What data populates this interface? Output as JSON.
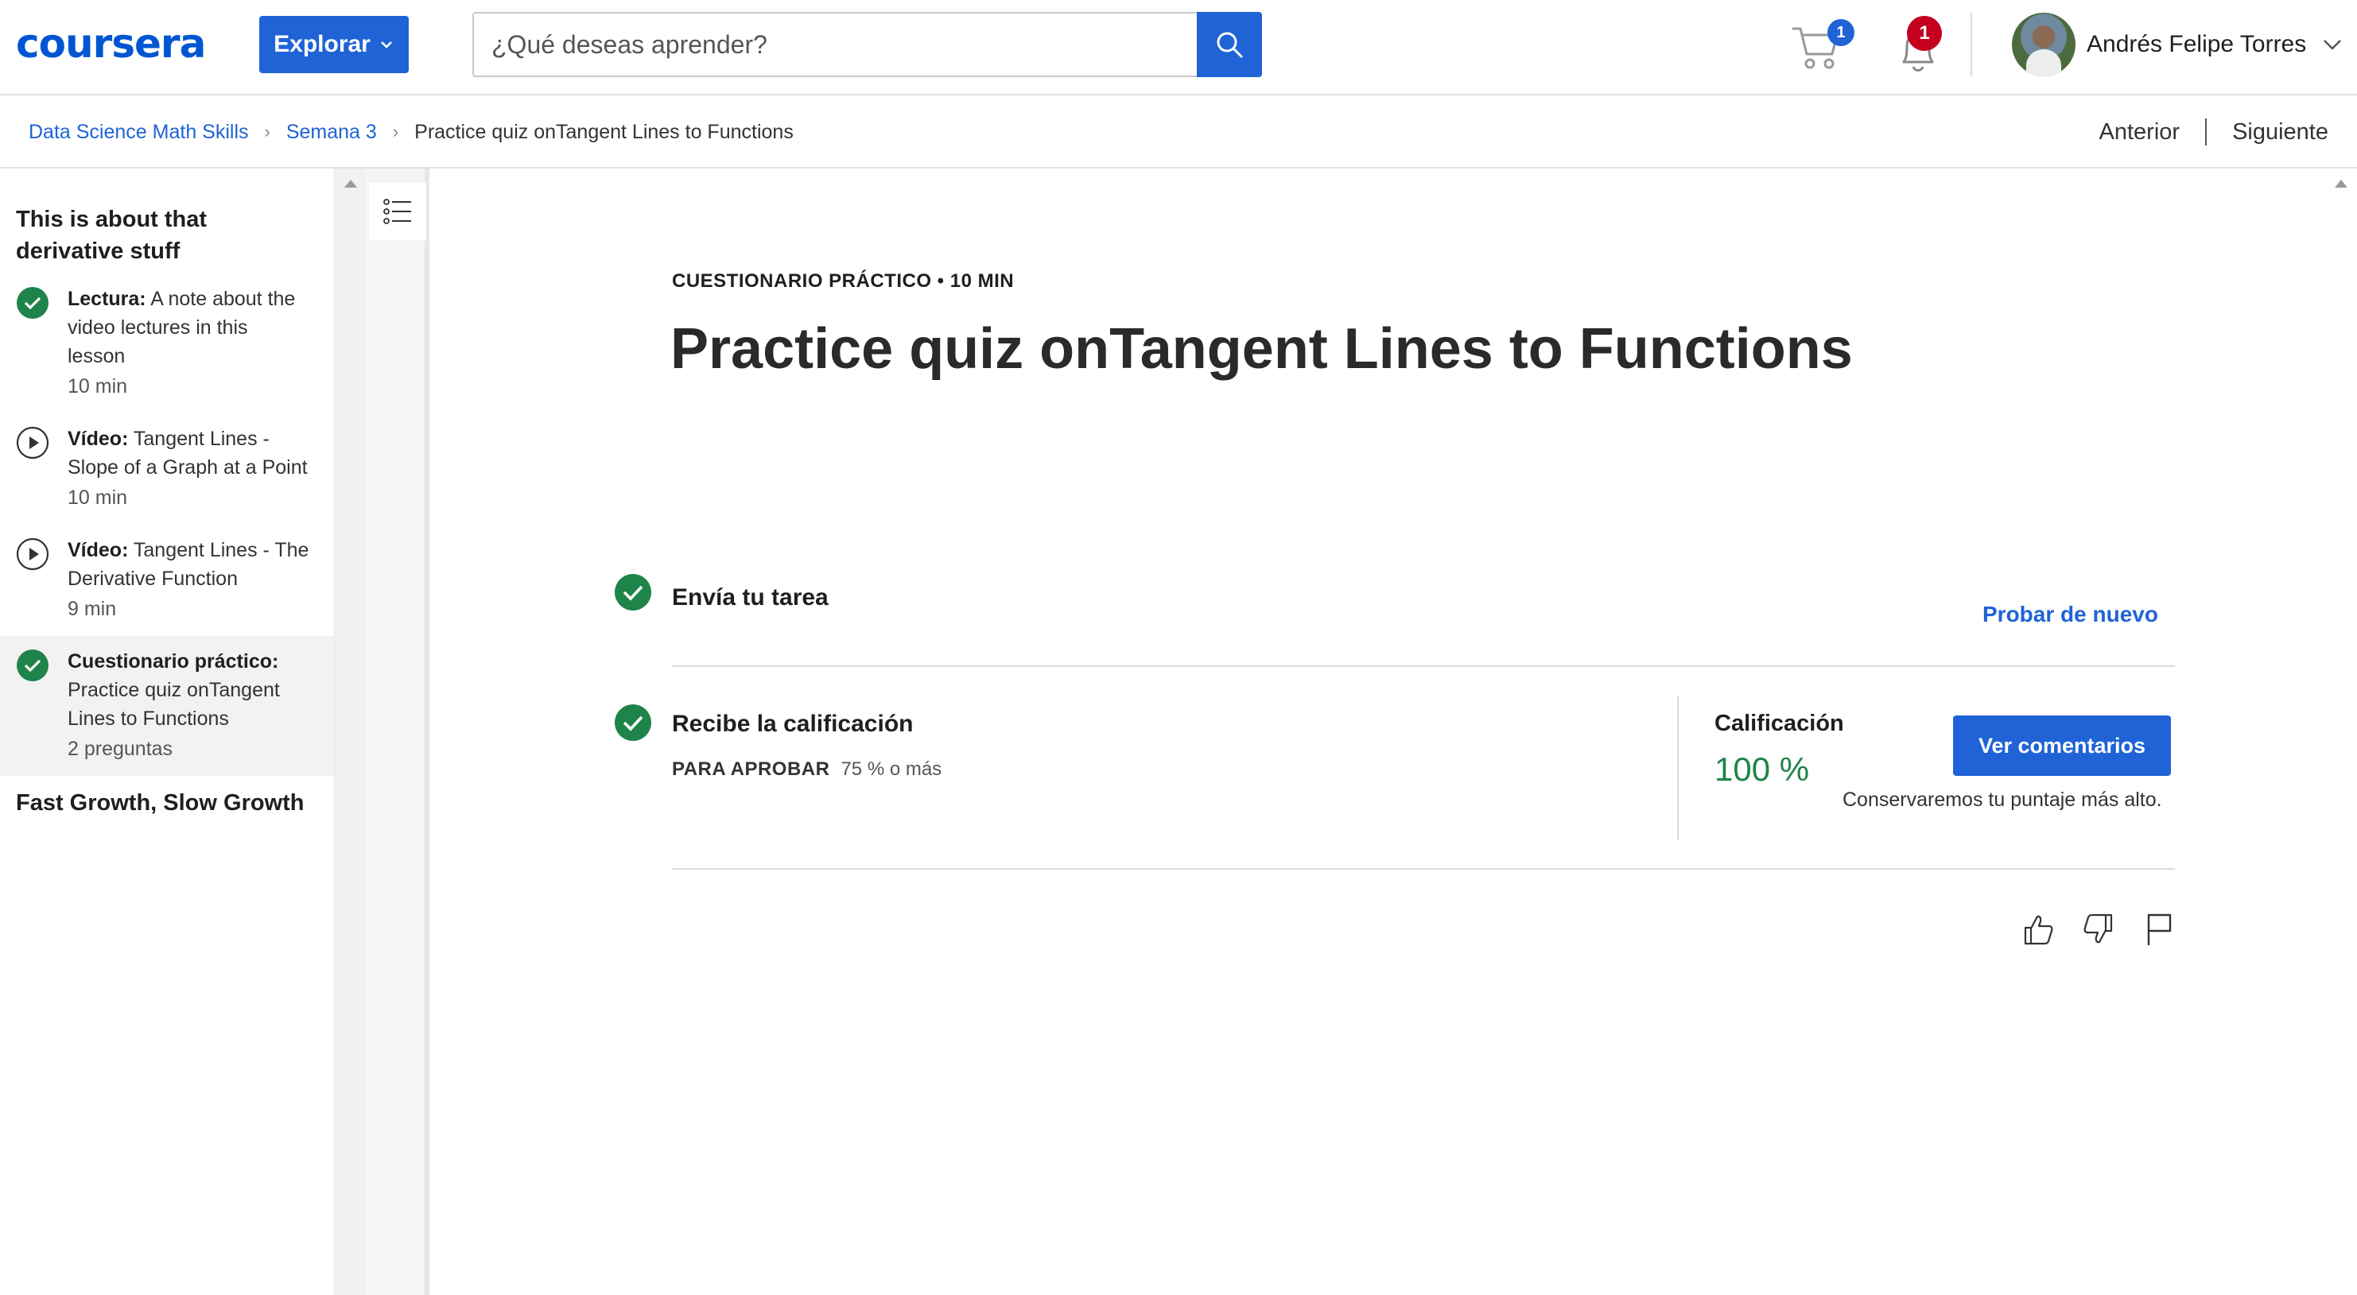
{
  "header": {
    "logo_text": "coursera",
    "explore_label": "Explorar",
    "search_placeholder": "¿Qué deseas aprender?",
    "cart_count": "1",
    "notifications_count": "1",
    "user_name": "Andrés Felipe Torres"
  },
  "breadcrumb": {
    "items": [
      "Data Science Math Skills",
      "Semana 3",
      "Practice quiz onTangent Lines to Functions"
    ],
    "prev_label": "Anterior",
    "next_label": "Siguiente"
  },
  "sidebar": {
    "section_1_title": "This is about that derivative stuff",
    "items": [
      {
        "kind": "Lectura:",
        "title": "A note about the video lectures in this lesson",
        "duration": "10 min",
        "status": "completed"
      },
      {
        "kind": "Vídeo:",
        "title": "Tangent Lines - Slope of a Graph at a Point",
        "duration": "10 min",
        "status": "video"
      },
      {
        "kind": "Vídeo:",
        "title": "Tangent Lines - The Derivative Function",
        "duration": "9 min",
        "status": "video"
      },
      {
        "kind": "Cuestionario práctico:",
        "title": "Practice quiz onTangent Lines to Functions",
        "duration": "2 preguntas",
        "status": "completed-active"
      }
    ],
    "section_2_title": "Fast Growth, Slow Growth"
  },
  "main": {
    "eyebrow": "CUESTIONARIO PRÁCTICO • 10 MIN",
    "title": "Practice quiz onTangent Lines to Functions",
    "submit_step": "Envía tu tarea",
    "retry_label": "Probar de nuevo",
    "grade_step": "Recibe la calificación",
    "pass_label": "PARA APROBAR",
    "pass_value": "75 % o más",
    "grade_label": "Calificación",
    "grade_value": "100 %",
    "feedback_button": "Ver comentarios",
    "keep_note": "Conservaremos tu puntaje más alto."
  },
  "colors": {
    "brand_blue": "#1f63d6",
    "success_green": "#1e8449",
    "alert_red": "#c4001e"
  }
}
